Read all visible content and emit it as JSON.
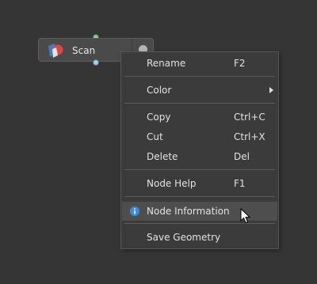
{
  "node": {
    "label": "Scan"
  },
  "menu": {
    "rename": {
      "label": "Rename",
      "shortcut": "F2"
    },
    "color": {
      "label": "Color"
    },
    "copy": {
      "label": "Copy",
      "shortcut": "Ctrl+C"
    },
    "cut": {
      "label": "Cut",
      "shortcut": "Ctrl+X"
    },
    "delete": {
      "label": "Delete",
      "shortcut": "Del"
    },
    "node_help": {
      "label": "Node Help",
      "shortcut": "F1"
    },
    "node_information": {
      "label": "Node Information",
      "icon": "info-icon"
    },
    "save_geometry": {
      "label": "Save Geometry"
    }
  },
  "colors": {
    "background": "#353535",
    "menu_bg": "#3b3b3b",
    "highlight": "#4e4e4e",
    "info_blue": "#3d8be0",
    "port_in": "#8ad08a",
    "port_out": "#a9cfe6"
  }
}
